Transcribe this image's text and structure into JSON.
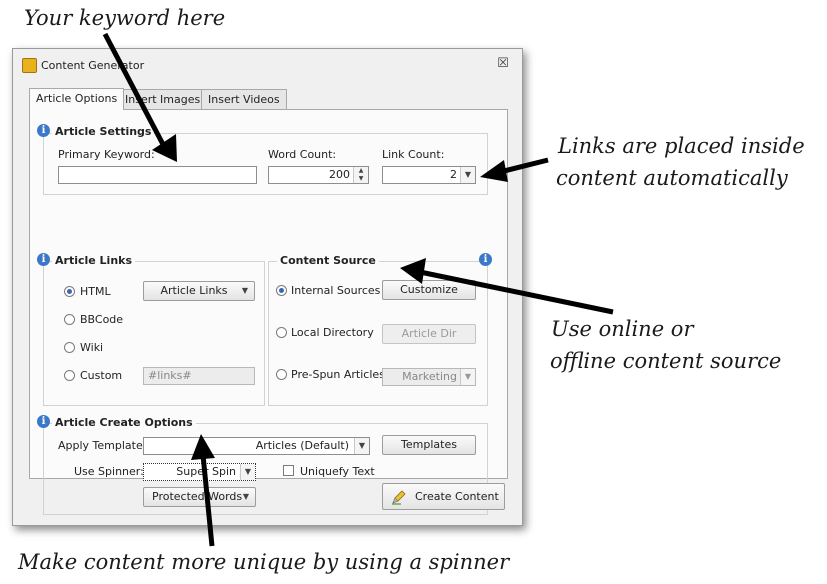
{
  "annotations": {
    "keyword": "Your keyword here",
    "links_line1": "Links are placed inside",
    "links_line2": "content automatically",
    "source_line1": "Use online or",
    "source_line2": "offline content source",
    "spinner": "Make content more unique by using a spinner"
  },
  "window": {
    "title": "Content Generator",
    "close_glyph": "☒"
  },
  "tabs": [
    {
      "label": "Article Options",
      "active": true
    },
    {
      "label": "Insert Images",
      "active": false
    },
    {
      "label": "Insert Videos",
      "active": false
    }
  ],
  "article_settings": {
    "heading": "Article Settings",
    "primary_keyword_label": "Primary Keyword:",
    "primary_keyword_value": "",
    "word_count_label": "Word Count:",
    "word_count_value": "200",
    "link_count_label": "Link Count:",
    "link_count_value": "2"
  },
  "article_links": {
    "heading": "Article Links",
    "options": [
      "HTML",
      "BBCode",
      "Wiki",
      "Custom"
    ],
    "selected": "HTML",
    "dropdown_label": "Article Links",
    "custom_value": "#links#"
  },
  "content_source": {
    "heading": "Content Source",
    "options": [
      "Internal Sources",
      "Local Directory",
      "Pre-Spun Articles"
    ],
    "selected": "Internal Sources",
    "customize_button": "Customize",
    "article_dir_button": "Article Dir",
    "marketing_value": "Marketing"
  },
  "create_options": {
    "heading": "Article Create Options",
    "apply_template_label": "Apply Template:",
    "template_value": "Articles (Default)",
    "templates_button": "Templates",
    "use_spinner_label": "Use Spinner:",
    "spinner_value": "Super Spin",
    "uniquefy_label": "Uniquefy Text",
    "protected_words_button": "Protected Words"
  },
  "footer": {
    "create_button": "Create Content"
  },
  "icons": {
    "info": "i",
    "spin_up": "▲",
    "spin_down": "▼",
    "dropdown": "▼"
  },
  "colors": {
    "accent": "#3b78c9",
    "title_icon": "#e8b21c"
  }
}
